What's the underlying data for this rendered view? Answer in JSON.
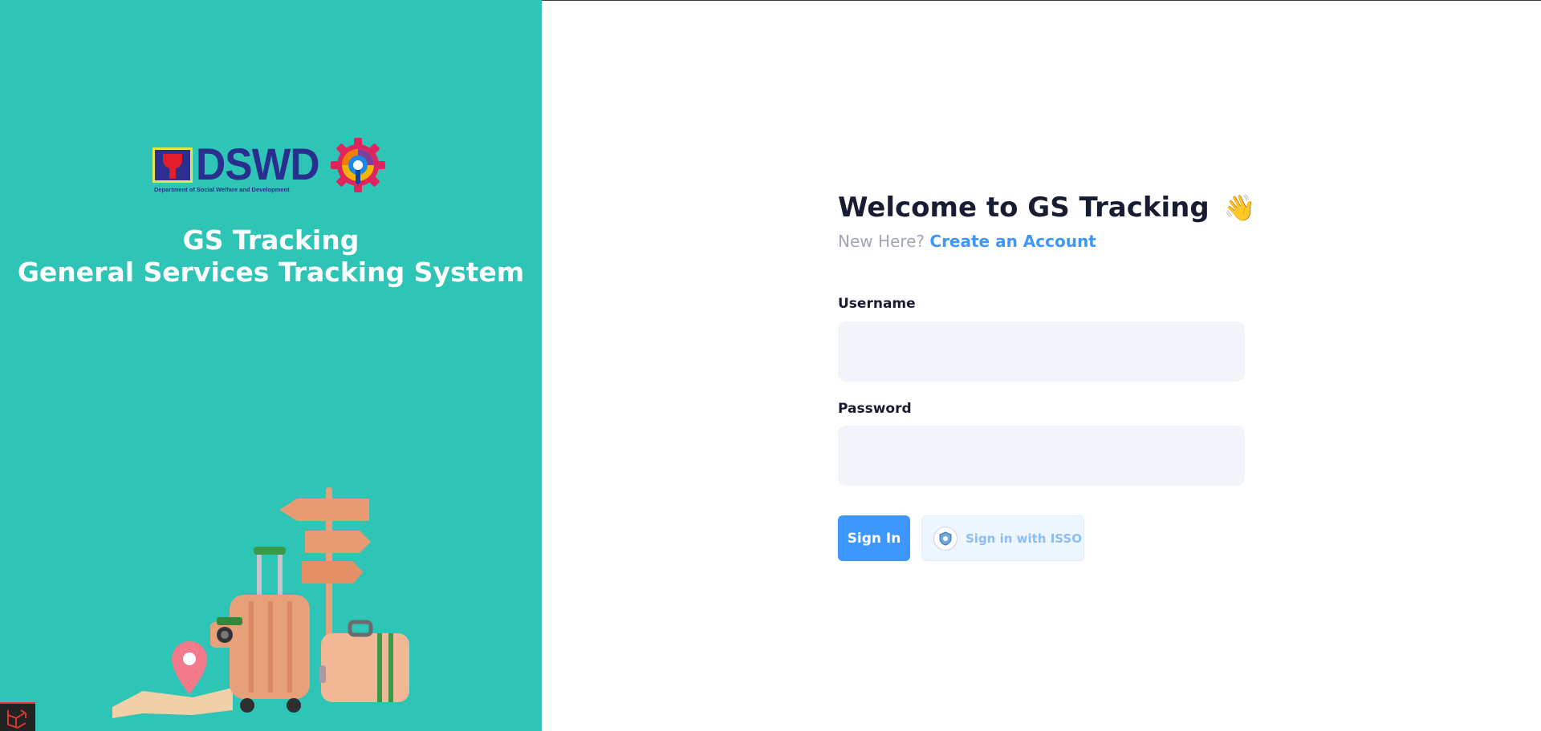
{
  "branding": {
    "dswd_wordmark": "DSWD",
    "dswd_tagline": "Department of Social Welfare and Development",
    "app_title_line1": "GS Tracking",
    "app_title_line2": "General Services Tracking System"
  },
  "login": {
    "heading": "Welcome to GS Tracking",
    "heading_emoji": "👋",
    "new_here": "New Here?",
    "create_account": "Create an Account",
    "username_label": "Username",
    "username_value": "",
    "password_label": "Password",
    "password_value": "",
    "sign_in": "Sign In",
    "sign_in_isso": "Sign in with ISSO"
  },
  "colors": {
    "left_panel_bg": "#2ec4b6",
    "primary": "#3e97ff",
    "input_bg": "#f1f4f8",
    "heading_text": "#181c32",
    "muted_text": "#a1a5b7"
  },
  "icons": {
    "gear": "gear-logo-icon",
    "isso": "isso-shield-icon",
    "laravel": "laravel-icon"
  }
}
